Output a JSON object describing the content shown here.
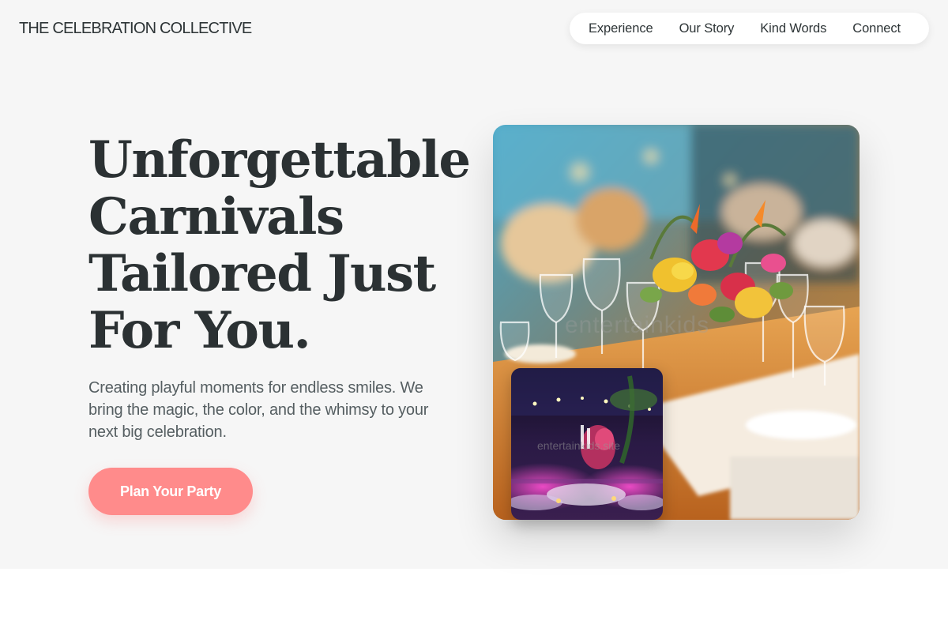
{
  "brand": {
    "name": "THE CELEBRATION COLLECTIVE"
  },
  "nav": {
    "items": [
      {
        "label": "Experience"
      },
      {
        "label": "Our Story"
      },
      {
        "label": "Kind Words"
      },
      {
        "label": "Connect"
      }
    ]
  },
  "hero": {
    "headline": [
      "Unforgettable",
      "Carnivals",
      "Tailored Just",
      "For You."
    ],
    "subtitle_lines": [
      "Creating playful moments for endless smiles. We",
      "bring the magic, the color, and the whimsy to your",
      "next big celebration."
    ],
    "cta_label": "Plan Your Party",
    "main_photo": {
      "subject": "floral centerpiece on banquet table with wine glasses",
      "watermark": "entertainkids"
    },
    "inset_photo": {
      "subject": "purple-lit event venue with round tables",
      "watermark": "entertainkids.site"
    }
  },
  "colors": {
    "hero_background": "#f6f6f6",
    "accent": "#ff8b8b",
    "text_dark": "#2b3133",
    "text_muted": "#555e61"
  }
}
